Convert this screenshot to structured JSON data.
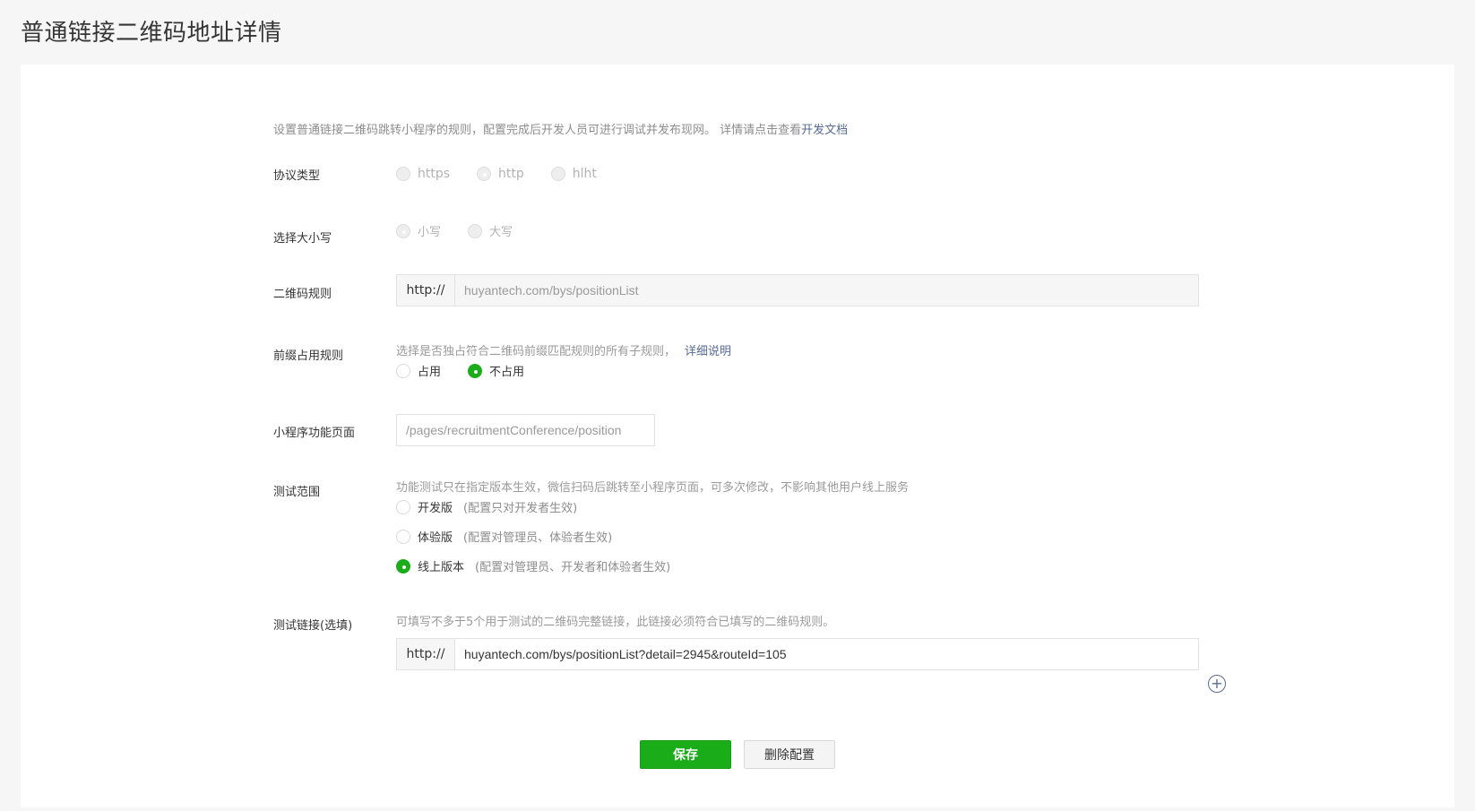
{
  "page": {
    "title": "普通链接二维码地址详情"
  },
  "intro": {
    "text": "设置普通链接二维码跳转小程序的规则，配置完成后开发人员可进行调试并发布现网。 详情请点击查看",
    "link": "开发文档"
  },
  "protocol": {
    "label": "协议类型",
    "options": [
      "https",
      "http",
      "hlht"
    ],
    "selected": "http"
  },
  "case": {
    "label": "选择大小写",
    "options": [
      "小写",
      "大写"
    ],
    "selected": "小写"
  },
  "qr_rule": {
    "label": "二维码规则",
    "prefix": "http://",
    "value": "huyantech.com/bys/positionList"
  },
  "prefix_rule": {
    "label": "前缀占用规则",
    "hint": "选择是否独占符合二维码前缀匹配规则的所有子规则，",
    "hint_link": "详细说明",
    "options": [
      "占用",
      "不占用"
    ],
    "selected": "不占用"
  },
  "mini_page": {
    "label": "小程序功能页面",
    "value": "/pages/recruitmentConference/position"
  },
  "test_scope": {
    "label": "测试范围",
    "hint": "功能测试只在指定版本生效，微信扫码后跳转至小程序页面，可多次修改，不影响其他用户线上服务",
    "options": [
      {
        "label": "开发版",
        "note": "(配置只对开发者生效)"
      },
      {
        "label": "体验版",
        "note": "(配置对管理员、体验者生效)"
      },
      {
        "label": "线上版本",
        "note": "(配置对管理员、开发者和体验者生效)"
      }
    ],
    "selected": "线上版本"
  },
  "test_link": {
    "label": "测试链接(选填)",
    "hint": "可填写不多于5个用于测试的二维码完整链接，此链接必须符合已填写的二维码规则。",
    "prefix": "http://",
    "value": "huyantech.com/bys/positionList?detail=2945&routeId=105",
    "add_icon": "plus-circle-icon"
  },
  "actions": {
    "save": "保存",
    "delete": "删除配置"
  },
  "colors": {
    "accent": "#1aad19",
    "link": "#576b95",
    "background": "#f6f6f6"
  }
}
